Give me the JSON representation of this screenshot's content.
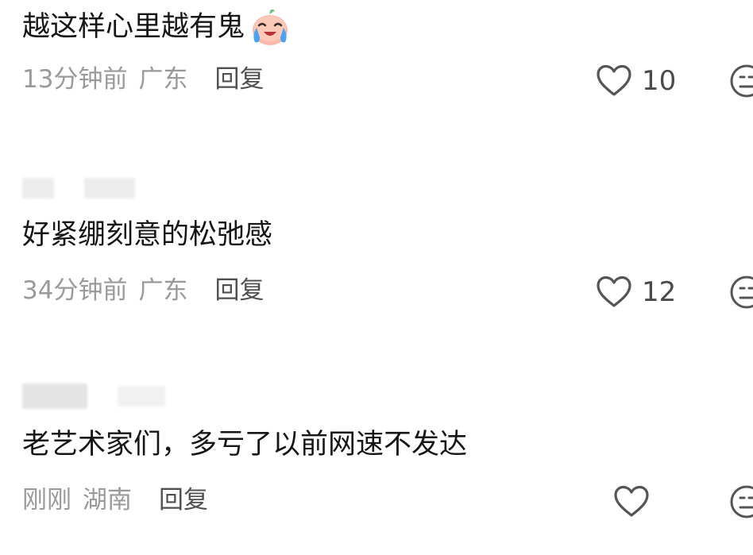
{
  "comments": [
    {
      "text": "越这样心里越有鬼",
      "emoji": "crying-laughing-emoji",
      "time": "13分钟前",
      "location": "广东",
      "reply_label": "回复",
      "likes": "10"
    },
    {
      "text": "好紧绷刻意的松弛感",
      "time": "34分钟前",
      "location": "广东",
      "reply_label": "回复",
      "likes": "12"
    },
    {
      "text": "老艺术家们，多亏了以前网速不发达",
      "time": "刚刚",
      "location": "湖南",
      "reply_label": "回复",
      "likes": ""
    }
  ],
  "icons": {
    "like": "heart-outline-icon",
    "dislike": "meh-face-icon"
  },
  "colors": {
    "meta_text": "#9a9a9a",
    "reply_text": "#505050",
    "icon_stroke": "#555555"
  }
}
